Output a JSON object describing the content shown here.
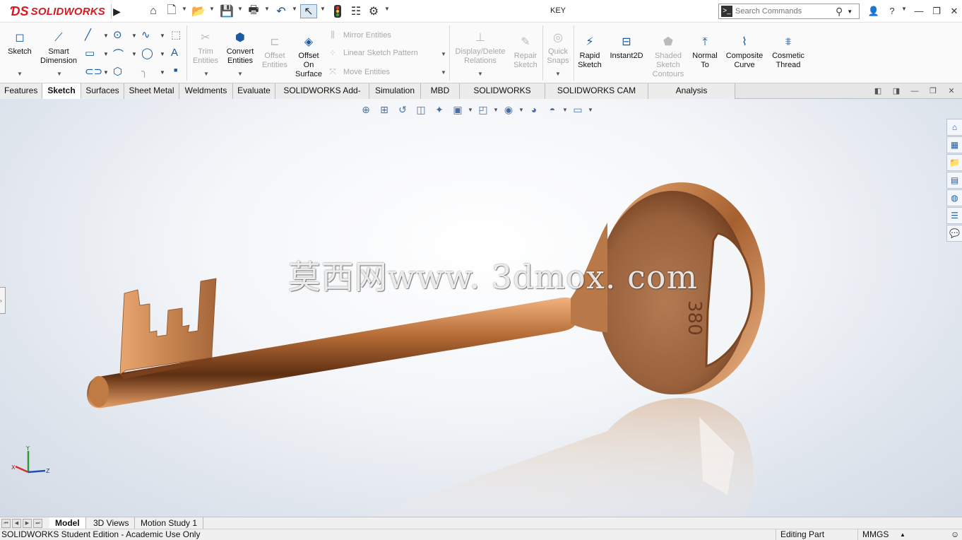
{
  "app": {
    "brand": "SOLIDWORKS",
    "document_title": "KEY"
  },
  "search": {
    "placeholder": "Search Commands"
  },
  "ribbon": {
    "sketch": "Sketch",
    "smart_dimension": [
      "Smart",
      "Dimension"
    ],
    "trim_entities": [
      "Trim",
      "Entities"
    ],
    "convert_entities": [
      "Convert",
      "Entities"
    ],
    "offset_entities": [
      "Offset",
      "Entities"
    ],
    "offset_on_surface": [
      "Offset",
      "On",
      "Surface"
    ],
    "mirror_entities": "Mirror Entities",
    "linear_sketch_pattern": "Linear Sketch Pattern",
    "move_entities": "Move Entities",
    "display_delete_relations": [
      "Display/Delete",
      "Relations"
    ],
    "repair_sketch": [
      "Repair",
      "Sketch"
    ],
    "quick_snaps": [
      "Quick",
      "Snaps"
    ],
    "rapid_sketch": [
      "Rapid",
      "Sketch"
    ],
    "instant2d": "Instant2D",
    "shaded_sketch_contours": [
      "Shaded",
      "Sketch",
      "Contours"
    ],
    "normal_to": [
      "Normal",
      "To"
    ],
    "composite_curve": [
      "Composite",
      "Curve"
    ],
    "cosmetic_thread": [
      "Cosmetic",
      "Thread"
    ]
  },
  "tabs": [
    "Features",
    "Sketch",
    "Surfaces",
    "Sheet Metal",
    "Weldments",
    "Evaluate",
    "SOLIDWORKS Add-Ins",
    "Simulation",
    "MBD",
    "SOLIDWORKS CAM",
    "SOLIDWORKS CAM TBM",
    "Analysis Preparation"
  ],
  "active_tab": "Sketch",
  "viewport": {
    "watermark": "莫西网www. 3dmox. com",
    "engraving": "380",
    "triad_axes": [
      "X",
      "Y",
      "Z"
    ]
  },
  "model_tabs": [
    "Model",
    "3D Views",
    "Motion Study 1"
  ],
  "status": {
    "edition": "SOLIDWORKS Student Edition - Academic Use Only",
    "mode": "Editing Part",
    "units": "MMGS"
  },
  "colors": {
    "brand_red": "#d71920",
    "key_bronze": "#b06a3a",
    "icon_blue": "#1a5aa0"
  }
}
